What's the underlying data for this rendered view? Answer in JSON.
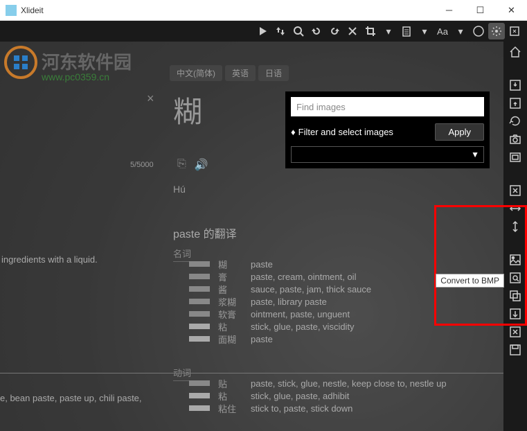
{
  "window": {
    "title": "Xlideit"
  },
  "watermark": {
    "text": "河东软件园",
    "url": "www.pc0359.cn"
  },
  "tabs": {
    "zh": "中文(简体)",
    "en": "英语",
    "jp": "日语"
  },
  "translate": {
    "close": "×",
    "counter": "5/5000",
    "big_char": "糊",
    "pinyin": "Hú",
    "section_title": "paste 的翻译",
    "sub_noun": "名词",
    "sub_verb": "动词",
    "ingredients": "ingredients with a liquid.",
    "paste_line": "e, bean paste, paste up, chili paste,",
    "nouns": [
      {
        "cn": "糊",
        "en": "paste"
      },
      {
        "cn": "膏",
        "en": "paste, cream, ointment, oil"
      },
      {
        "cn": "酱",
        "en": "sauce, paste, jam, thick sauce"
      },
      {
        "cn": "浆糊",
        "en": "paste, library paste"
      },
      {
        "cn": "软膏",
        "en": "ointment, paste, unguent"
      },
      {
        "cn": "粘",
        "en": "stick, glue, paste, viscidity"
      },
      {
        "cn": "面糊",
        "en": "paste"
      }
    ],
    "verbs": [
      {
        "cn": "贴",
        "en": "paste, stick, glue, nestle, keep close to, nestle up"
      },
      {
        "cn": "粘",
        "en": "stick, glue, paste, adhibit"
      },
      {
        "cn": "粘住",
        "en": "stick to, paste, stick down"
      }
    ]
  },
  "search": {
    "placeholder": "Find images",
    "filter_label": "Filter and select images",
    "apply": "Apply"
  },
  "tooltip": {
    "convert_bmp": "Convert to BMP"
  }
}
